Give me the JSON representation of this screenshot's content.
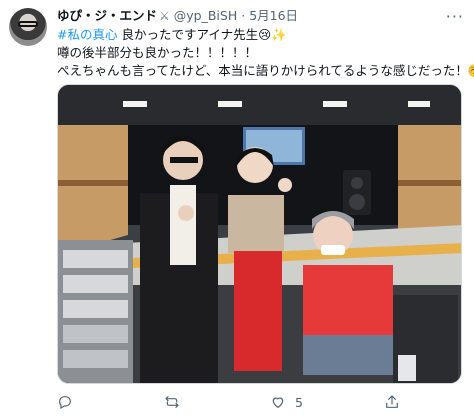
{
  "tweet": {
    "display_name": "ゆぴ・ジ・エンド",
    "badge_icon": "crossed-swords-icon",
    "handle": "@yp_BiSH",
    "separator": "·",
    "date": "5月16日",
    "more_label": "···",
    "line1_hashtag": "#私の真心",
    "line1_text": " 良かったですアイナ先生😢✨",
    "line2": "噂の後半部分も良かった！！！！！",
    "line3": "ぺえちゃんも言ってたけど、本当に語りかけられてるような感じだった！☺️",
    "image_alt": "Photo of three people in a recording studio"
  },
  "actions": {
    "reply": {
      "icon": "reply-icon",
      "count": ""
    },
    "retweet": {
      "icon": "retweet-icon",
      "count": ""
    },
    "like": {
      "icon": "heart-icon",
      "count": "5"
    },
    "share": {
      "icon": "share-icon",
      "count": ""
    }
  },
  "colors": {
    "link": "#1d9bf0",
    "muted": "#536471",
    "text": "#0f1419"
  }
}
